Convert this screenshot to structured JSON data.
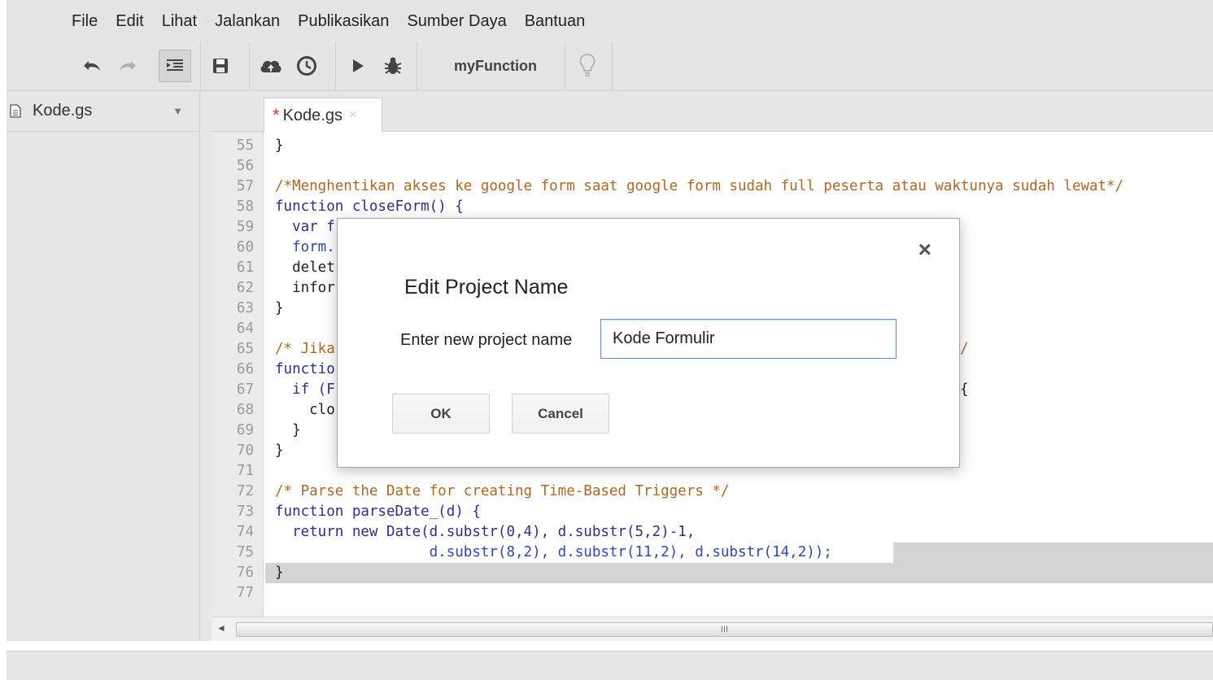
{
  "menubar": {
    "items": [
      "File",
      "Edit",
      "Lihat",
      "Jalankan",
      "Publikasikan",
      "Sumber Daya",
      "Bantuan"
    ]
  },
  "toolbar": {
    "function_name": "myFunction"
  },
  "sidebar": {
    "file_name": "Kode.gs"
  },
  "editor": {
    "tab": {
      "modified_marker": "*",
      "label": "Kode.gs",
      "close": "×"
    },
    "lines": [
      {
        "n": "55",
        "text": "}"
      },
      {
        "n": "56",
        "text": ""
      },
      {
        "n": "57",
        "text": "/*Menghentikan akses ke google form saat google form sudah full peserta atau waktunya sudah lewat*/"
      },
      {
        "n": "58",
        "text": "function closeForm() {"
      },
      {
        "n": "59",
        "text": "  var f"
      },
      {
        "n": "60",
        "text": "  form."
      },
      {
        "n": "61",
        "text": "  delet"
      },
      {
        "n": "62",
        "text": "  infor"
      },
      {
        "n": "63",
        "text": "}"
      },
      {
        "n": "64",
        "text": ""
      },
      {
        "n": "65",
        "text": "/* Jika"
      },
      {
        "n": "66",
        "text": "functio"
      },
      {
        "n": "67",
        "text": "  if (F"
      },
      {
        "n": "68",
        "text": "    clo"
      },
      {
        "n": "69",
        "text": "  }"
      },
      {
        "n": "70",
        "text": "}"
      },
      {
        "n": "71",
        "text": ""
      },
      {
        "n": "72",
        "text": "/* Parse the Date for creating Time-Based Triggers */"
      },
      {
        "n": "73",
        "text": "function parseDate_(d) {"
      },
      {
        "n": "74",
        "text": "  return new Date(d.substr(0,4), d.substr(5,2)-1,"
      },
      {
        "n": "75",
        "text": "                  d.substr(8,2), d.substr(11,2), d.substr(14,2));"
      },
      {
        "n": "76",
        "text": "}"
      },
      {
        "n": "77",
        "text": ""
      }
    ],
    "right_fragments": {
      "line65": "/",
      "line67": "{"
    }
  },
  "scrollbar": {
    "grip": "III"
  },
  "dialog": {
    "close": "×",
    "title": "Edit Project Name",
    "label": "Enter new project name",
    "input_value": "Kode Formulir",
    "ok": "OK",
    "cancel": "Cancel"
  },
  "colors": {
    "comment": "#b5651d",
    "keyword": "#2c2c9c",
    "number": "#0a8a2a",
    "focus": "#4d90fe",
    "modified": "#d0392b"
  }
}
